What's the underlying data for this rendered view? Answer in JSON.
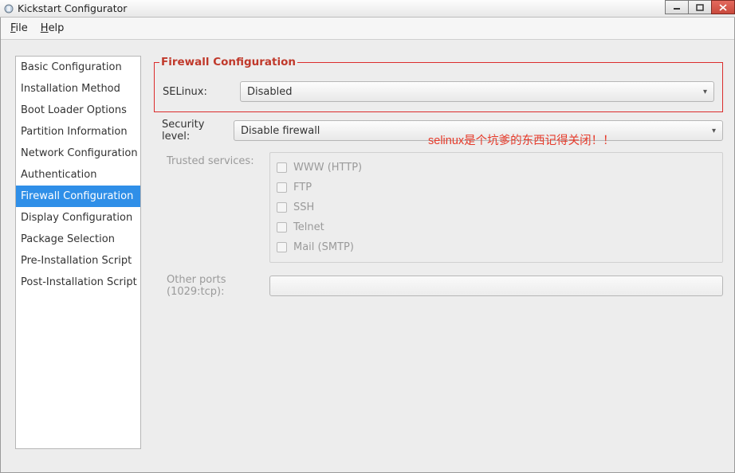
{
  "window": {
    "title": "Kickstart Configurator"
  },
  "menu": {
    "file_prefix": "F",
    "file_rest": "ile",
    "help_prefix": "H",
    "help_rest": "elp"
  },
  "sidebar": {
    "items": [
      {
        "label": "Basic Configuration"
      },
      {
        "label": "Installation Method"
      },
      {
        "label": "Boot Loader Options"
      },
      {
        "label": "Partition Information"
      },
      {
        "label": "Network Configuration"
      },
      {
        "label": "Authentication"
      },
      {
        "label": "Firewall Configuration"
      },
      {
        "label": "Display Configuration"
      },
      {
        "label": "Package Selection"
      },
      {
        "label": "Pre-Installation Script"
      },
      {
        "label": "Post-Installation Script"
      }
    ],
    "selected_index": 6
  },
  "panel": {
    "title": "Firewall Configuration",
    "selinux_label": "SELinux:",
    "selinux_value": "Disabled",
    "security_label": "Security level:",
    "security_value": "Disable firewall",
    "trusted_label": "Trusted services:",
    "services": [
      {
        "label": "WWW (HTTP)"
      },
      {
        "label": "FTP"
      },
      {
        "label": "SSH"
      },
      {
        "label": "Telnet"
      },
      {
        "label": "Mail (SMTP)"
      }
    ],
    "ports_label": "Other ports (1029:tcp):"
  },
  "annotation": "selinux是个坑爹的东西记得关闭！！"
}
